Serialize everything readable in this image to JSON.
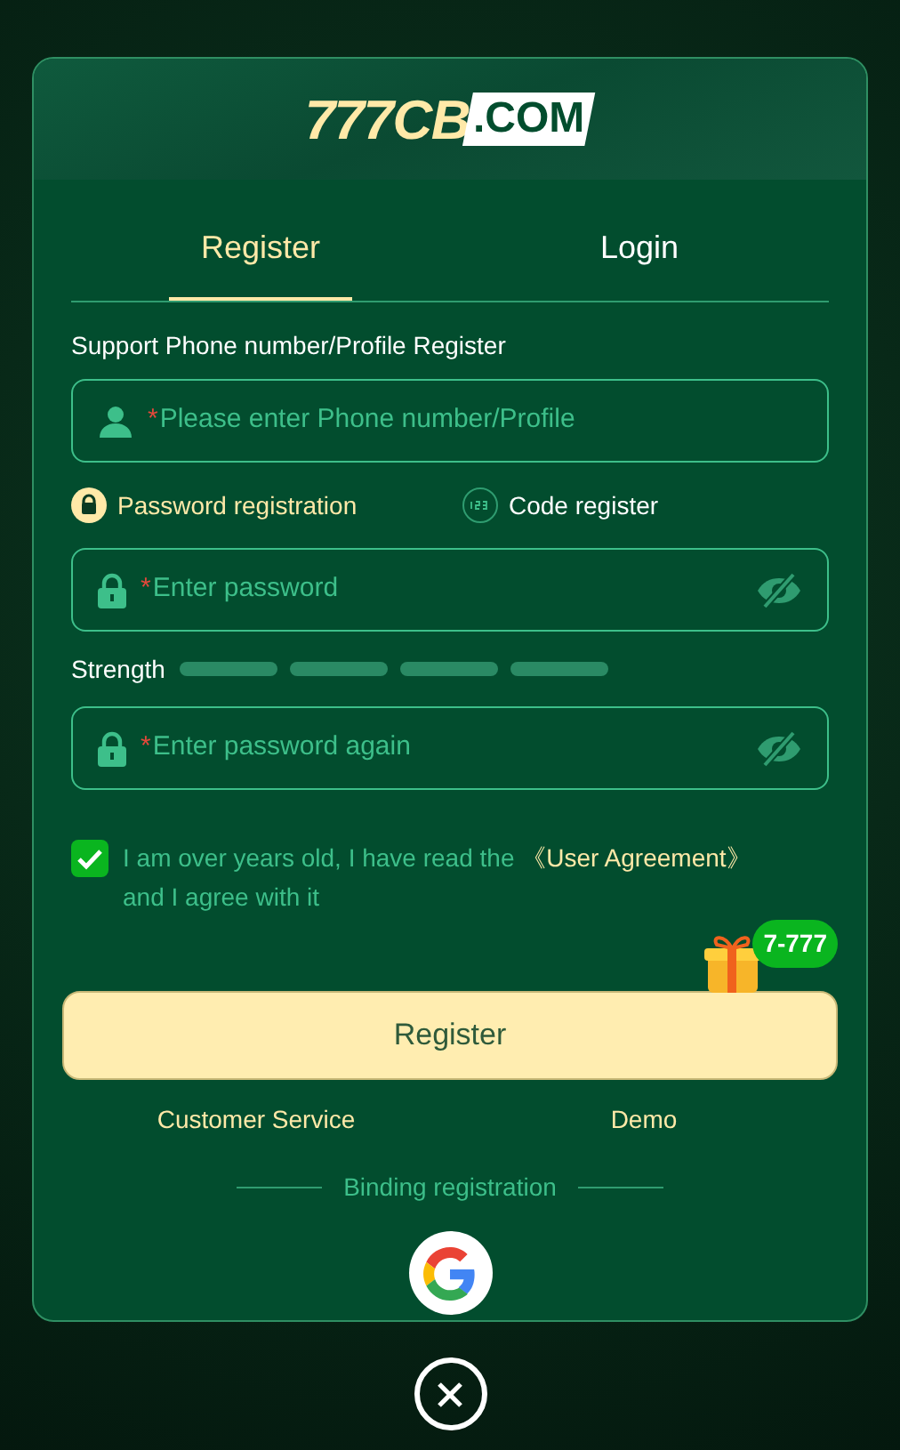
{
  "logo": {
    "main": "777CB",
    "suffix": ".COM"
  },
  "tabs": [
    {
      "label": "Register",
      "selected": true
    },
    {
      "label": "Login",
      "selected": false
    }
  ],
  "account_label": "Support Phone number/Profile Register",
  "account_field": {
    "kind": "account",
    "marker": "*",
    "placeholder": "Please enter Phone number/Profile"
  },
  "methods": [
    {
      "kind": "password",
      "label": "Password registration",
      "selected": true
    },
    {
      "kind": "code",
      "label": "Code register",
      "selected": false
    }
  ],
  "password_fields": [
    {
      "kind": "password",
      "marker": "*",
      "placeholder": "Enter password"
    }
  ],
  "strength": {
    "label": "Strength"
  },
  "confirm_field": {
    "kind": "password",
    "marker": "*",
    "placeholder": "Enter password again"
  },
  "agreement": {
    "checked": true,
    "text_before": "I am over years old, I have read the ",
    "link": "《User Agreement》",
    "text_after": " and I agree with it"
  },
  "bonus_badge": "7-777",
  "submit": "Register",
  "links": [
    "Customer Service",
    "Demo"
  ],
  "divider_label": "Binding registration",
  "social": [
    {
      "kind": "google"
    }
  ]
}
